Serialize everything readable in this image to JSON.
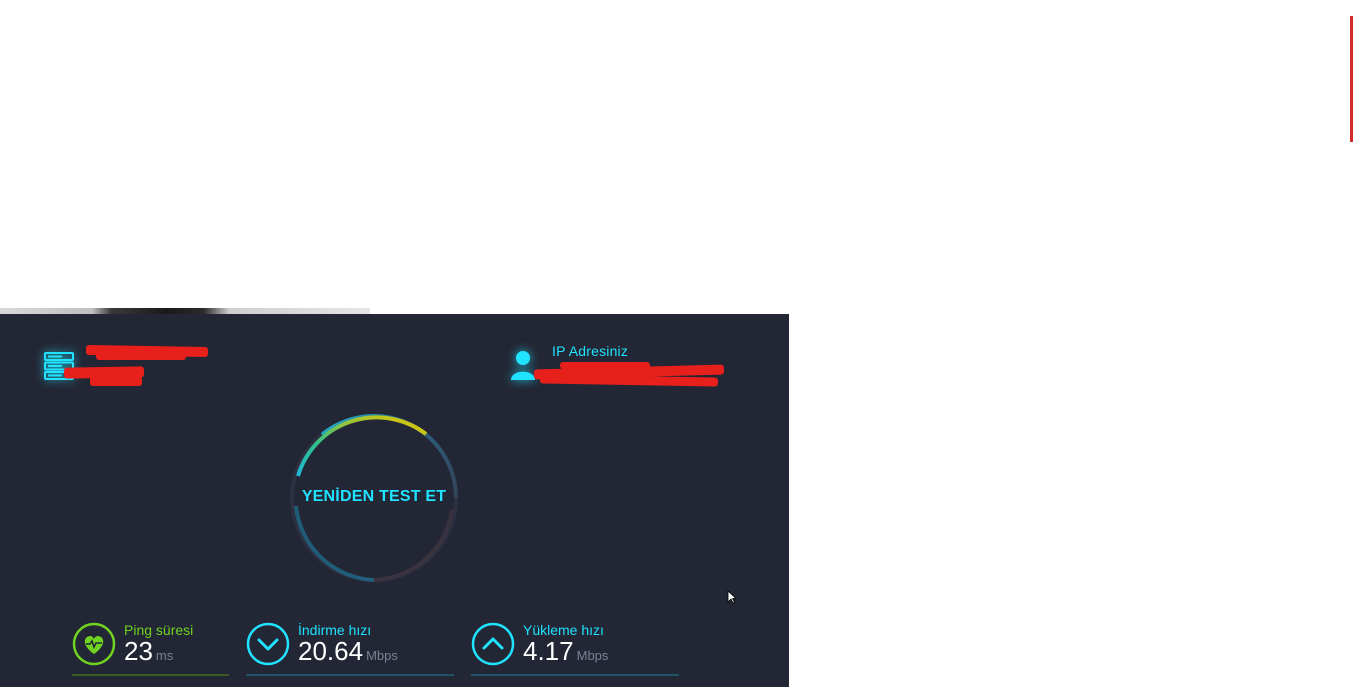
{
  "speedtest": {
    "server": {
      "name": "",
      "location": "",
      "icon": "server-icon",
      "redacted": true
    },
    "ip": {
      "label": "IP Adresiniz",
      "value": "",
      "icon": "user-icon",
      "redacted": true
    },
    "go_button": {
      "label": "YENİDEN TEST ET"
    },
    "results": {
      "ping": {
        "label": "Ping süresi",
        "value": "23",
        "unit": "ms",
        "icon": "heart-pulse-icon",
        "color": "#6fd320"
      },
      "download": {
        "label": "İndirme hızı",
        "value": "20.64",
        "unit": "Mbps",
        "icon": "chevron-down-icon",
        "color": "#1fe3ff"
      },
      "upload": {
        "label": "Yükleme hızı",
        "value": "4.17",
        "unit": "Mbps",
        "icon": "chevron-up-icon",
        "color": "#1fe3ff"
      }
    },
    "colors": {
      "panel_bg": "#232634",
      "accent": "#1fe3ff",
      "ping_accent": "#6fd320",
      "redaction": "#e8201c"
    }
  }
}
